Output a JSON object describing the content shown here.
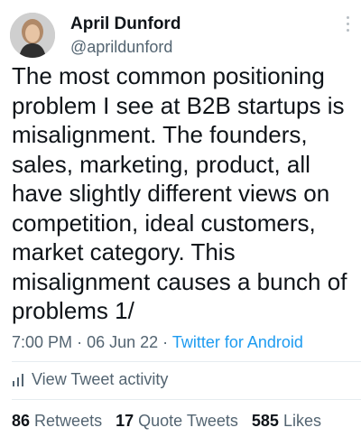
{
  "author": {
    "name": "April Dunford",
    "handle": "@aprildunford"
  },
  "tweet": {
    "text": "The most common positioning\nproblem I see at B2B startups is\nmisalignment. The founders,\nsales, marketing, product, all\nhave slightly different views on\ncompetition, ideal customers,\nmarket category. This\nmisalignment causes a bunch of\nproblems 1/",
    "time": "7:00 PM",
    "date": "06 Jun 22",
    "source": "Twitter for Android"
  },
  "activity_label": "View Tweet activity",
  "stats": {
    "retweets_count": "86",
    "retweets_label": "Retweets",
    "quotes_count": "17",
    "quotes_label": "Quote Tweets",
    "likes_count": "585",
    "likes_label": "Likes"
  },
  "colors": {
    "text": "#0f1419",
    "muted": "#536471",
    "link": "#1d9bf0"
  },
  "icons": {
    "more": "more-vertical-icon",
    "activity": "bar-chart-icon"
  }
}
